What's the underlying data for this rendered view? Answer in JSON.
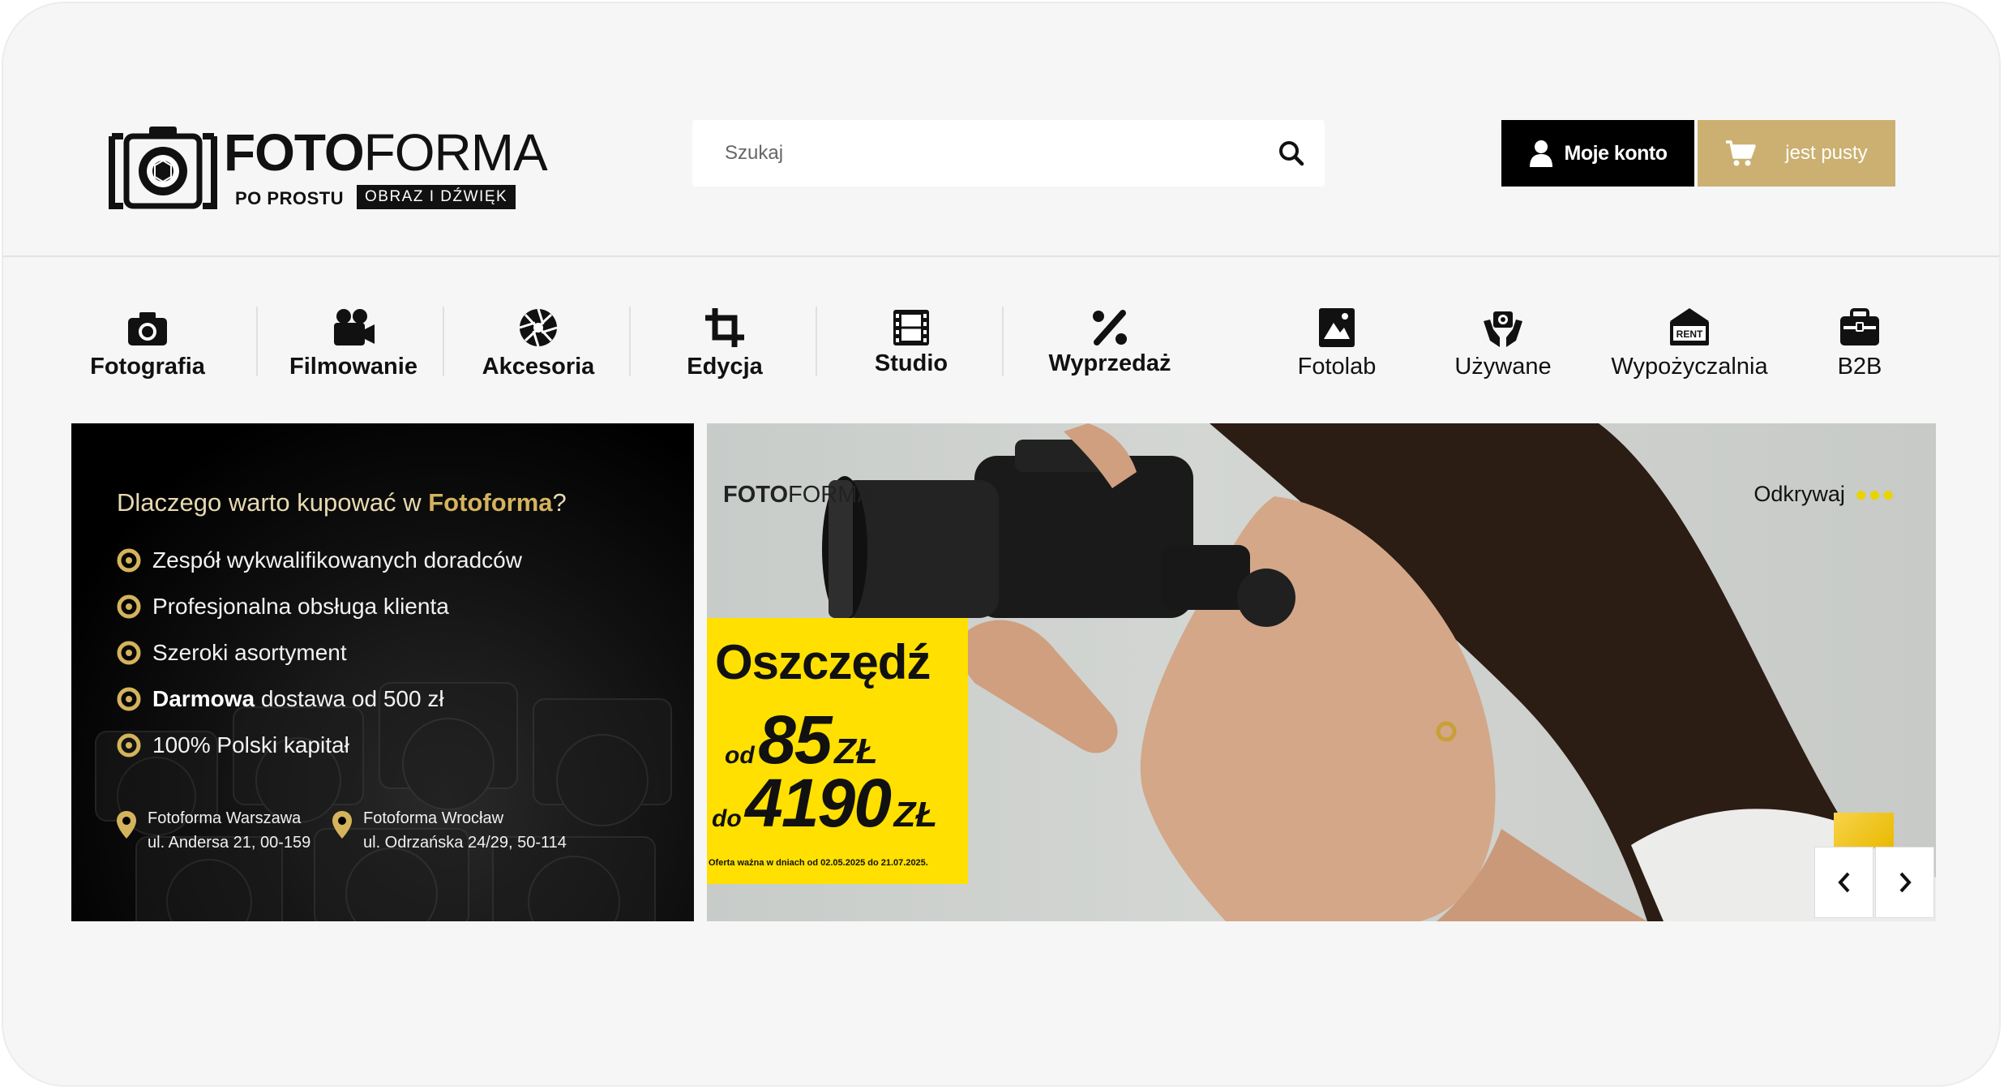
{
  "header": {
    "logo": {
      "brand_bold": "FOTO",
      "brand_light": "FORMA",
      "tagline_left": "PO PROSTU",
      "tagline_right": "OBRAZ I DŹWIĘK"
    },
    "search": {
      "placeholder": "Szukaj",
      "icon": "search-icon"
    },
    "account": {
      "label": "Moje konto",
      "icon": "user-icon"
    },
    "cart": {
      "label": "jest pusty",
      "icon": "cart-icon",
      "color": "#cbb071"
    }
  },
  "nav": {
    "items": [
      {
        "label": "Fotografia",
        "icon": "camera-icon"
      },
      {
        "label": "Filmowanie",
        "icon": "video-camera-icon"
      },
      {
        "label": "Akcesoria",
        "icon": "aperture-icon"
      },
      {
        "label": "Edycja",
        "icon": "crop-icon"
      },
      {
        "label": "Studio",
        "icon": "film-strip-icon"
      },
      {
        "label": "Wyprzedaż",
        "icon": "percent-icon"
      },
      {
        "label": "Fotolab",
        "icon": "photo-print-icon"
      },
      {
        "label": "Używane",
        "icon": "hands-camera-icon"
      },
      {
        "label": "Wypożyczalnia",
        "icon": "rent-icon"
      },
      {
        "label": "B2B",
        "icon": "briefcase-icon"
      }
    ],
    "rent_badge": "RENT"
  },
  "promo_left": {
    "heading_prefix": "Dlaczego warto kupować w ",
    "heading_brand": "Fotoforma",
    "heading_suffix": "?",
    "points": [
      {
        "bold": "",
        "text": "Zespół wykwalifikowanych doradców"
      },
      {
        "bold": "",
        "text": "Profesjonalna obsługa klienta"
      },
      {
        "bold": "",
        "text": "Szeroki asortyment"
      },
      {
        "bold": "Darmowa",
        "text": " dostawa od 500 zł"
      },
      {
        "bold": "",
        "text": "100% Polski kapitał"
      }
    ],
    "stores": [
      {
        "name": "Fotoforma Warszawa",
        "address": "ul. Andersa 21, 00-159"
      },
      {
        "name": "Fotoforma Wrocław",
        "address": "ul. Odrzańska 24/29, 50-114"
      }
    ],
    "accent_color": "#d4b35c"
  },
  "hero": {
    "mini_logo_bold": "FOTO",
    "mini_logo_light": "FORMA",
    "discover_label": "Odkrywaj",
    "offer": {
      "headline": "Oszczędź",
      "from_prefix": "od",
      "from_value": "85",
      "from_currency": "ZŁ",
      "to_prefix": "do",
      "to_value": "4190",
      "to_currency": "ZŁ",
      "note": "Oferta ważna w dniach od 02.05.2025 do 21.07.2025."
    },
    "offer_color": "#ffe000",
    "prev_icon": "chevron-left-icon",
    "next_icon": "chevron-right-icon"
  }
}
